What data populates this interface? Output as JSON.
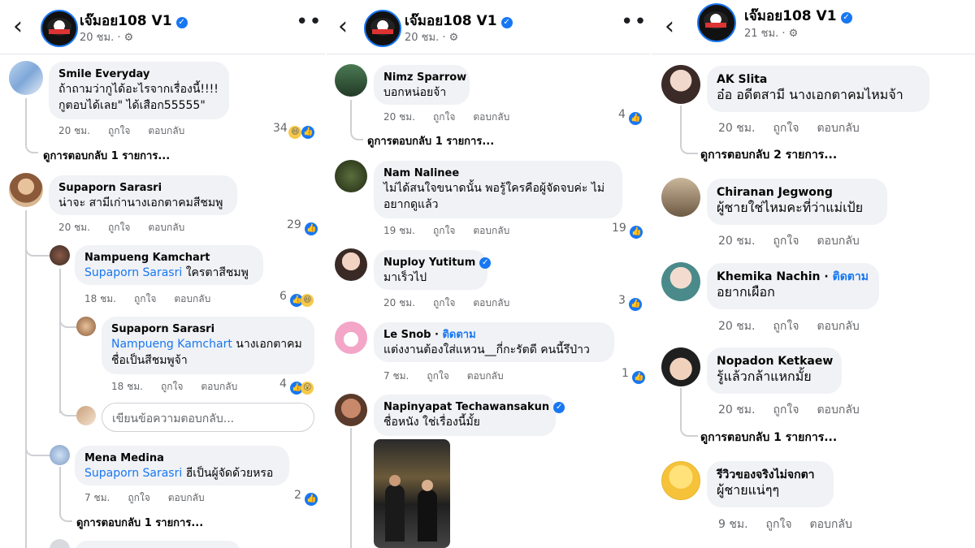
{
  "panels": [
    {
      "page_name": "เจ๊มอย108 V1",
      "time": "20 ชม.",
      "comments": [
        {
          "name": "Smile Everyday",
          "text1": "ถ้าถามว่ากูได้อะไรจากเรื่องนี้!!!!",
          "text2": "กูตอบได้เลย\" ได้เสือก55555\"",
          "time": "20 ชม.",
          "like": "ถูกใจ",
          "reply": "ตอบกลับ",
          "count": "34",
          "more": "ดูการตอบกลับ 1 รายการ..."
        },
        {
          "name": "Supaporn Sarasri",
          "text1": "น่าจะ สามีเก่านางเอกตาคมสีชมพู",
          "time": "20 ชม.",
          "like": "ถูกใจ",
          "reply": "ตอบกลับ",
          "count": "29"
        },
        {
          "name": "Nampueng Kamchart",
          "mention": "Supaporn Sarasri",
          "text1": " ใครตาสีชมพู",
          "time": "18 ชม.",
          "like": "ถูกใจ",
          "reply": "ตอบกลับ",
          "count": "6"
        },
        {
          "name": "Supaporn Sarasri",
          "mention": "Nampueng Kamchart",
          "text1": " นางเอกตาคม",
          "text2": "ชื่อเป็นสีชมพูจ้า",
          "time": "18 ชม.",
          "like": "ถูกใจ",
          "reply": "ตอบกลับ",
          "count": "4"
        },
        {
          "name": "Mena Medina",
          "mention": "Supaporn Sarasri",
          "text1": " ฮีเป็นผู้จัดด้วยหรอ",
          "time": "7 ชม.",
          "like": "ถูกใจ",
          "reply": "ตอบกลับ",
          "count": "2",
          "more": "ดูการตอบกลับ 1 รายการ..."
        }
      ],
      "reply_placeholder": "เขียนข้อความตอบกลับ..."
    },
    {
      "page_name": "เจ๊มอย108 V1",
      "time": "20 ชม.",
      "comments": [
        {
          "name": "Nimz Sparrow",
          "text1": "บอกหน่อยจ้า",
          "time": "20 ชม.",
          "like": "ถูกใจ",
          "reply": "ตอบกลับ",
          "count": "4",
          "more": "ดูการตอบกลับ 1 รายการ..."
        },
        {
          "name": "Nam Nalinee",
          "text1": "ไม่ได้สนใจขนาดนั้น พอรู้ใครคือผู้จัดจบค่ะ ไม่",
          "text2": "อยากดูแล้ว",
          "time": "19 ชม.",
          "like": "ถูกใจ",
          "reply": "ตอบกลับ",
          "count": "19"
        },
        {
          "name": "Nuploy Yutitum",
          "text1": "มาเร็วไป",
          "time": "20 ชม.",
          "like": "ถูกใจ",
          "reply": "ตอบกลับ",
          "count": "3"
        },
        {
          "name": "Le Snob",
          "follow": "ติดตาม",
          "text1": "แต่งงานต้องใส่แหวน__กี่กะรัตดี  คนนี้รึป่าว",
          "time": "7 ชม.",
          "like": "ถูกใจ",
          "reply": "ตอบกลับ",
          "count": "1"
        },
        {
          "name": "Napinyapat Techawansakun",
          "text1": "ชื่อหนัง ใช่เรื่องนี้มั้ย"
        }
      ]
    },
    {
      "page_name": "เจ๊มอย108 V1",
      "time": "21 ชม.",
      "comments": [
        {
          "name": "AK Slita",
          "text1": "อ๋อ อดีตสามี นางเอกตาคมไหมจ้า",
          "time": "20 ชม.",
          "like": "ถูกใจ",
          "reply": "ตอบกลับ",
          "more": "ดูการตอบกลับ 2 รายการ..."
        },
        {
          "name": "Chiranan Jegwong",
          "text1": "ผู้ชายใช่ไหมคะที่ว่าแม่เป้ย",
          "time": "20 ชม.",
          "like": "ถูกใจ",
          "reply": "ตอบกลับ"
        },
        {
          "name": "Khemika Nachin",
          "follow": "ติดตาม",
          "text1": "อยากเผือก",
          "time": "20 ชม.",
          "like": "ถูกใจ",
          "reply": "ตอบกลับ"
        },
        {
          "name": "Nopadon Ketkaew",
          "text1": "รู้แล้วกล้าแหกมั้ย",
          "time": "20 ชม.",
          "like": "ถูกใจ",
          "reply": "ตอบกลับ",
          "more": "ดูการตอบกลับ 1 รายการ..."
        },
        {
          "name": "รีวิวของจริงไม่จกตา",
          "text1": "ผู้ชายแน่ๆๆ",
          "time": "9 ชม.",
          "like": "ถูกใจ",
          "reply": "ตอบกลับ"
        }
      ]
    }
  ]
}
